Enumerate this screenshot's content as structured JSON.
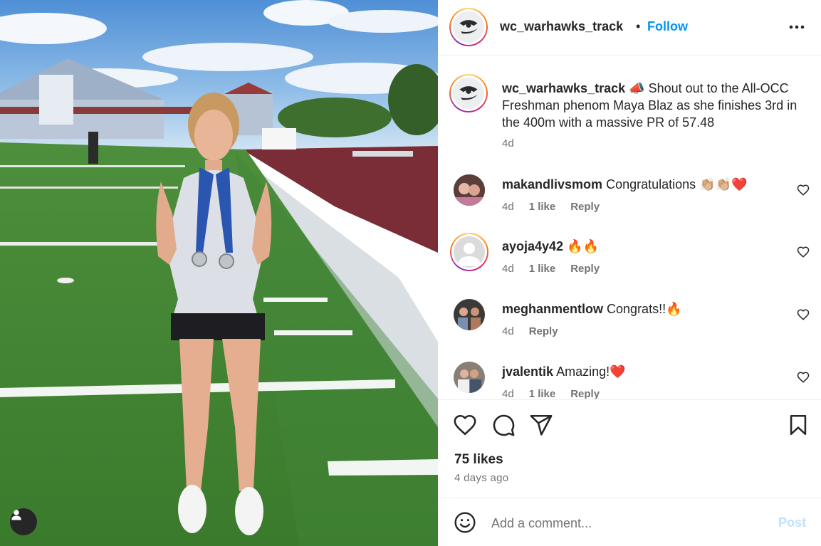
{
  "post": {
    "username": "wc_warhawks_track",
    "follow_label": "Follow",
    "separator": "•",
    "caption_emoji": "📣",
    "caption_text": "Shout out to the All-OCC Freshman phenom Maya Blaz as she finishes 3rd in the 400m with a massive PR of 57.48",
    "caption_time": "4d"
  },
  "comments": [
    {
      "username": "makandlivsmom",
      "text": "Congratulations 👏🏼👏🏼❤️",
      "time": "4d",
      "likes": "1 like",
      "reply": "Reply"
    },
    {
      "username": "ayoja4y42",
      "text": "🔥🔥",
      "time": "4d",
      "likes": "1 like",
      "reply": "Reply"
    },
    {
      "username": "meghanmentlow",
      "text": "Congrats!!🔥",
      "time": "4d",
      "reply": "Reply"
    },
    {
      "username": "jvalentik",
      "text": "Amazing!❤️",
      "time": "4d",
      "likes": "1 like",
      "reply": "Reply"
    }
  ],
  "stats": {
    "likes": "75 likes",
    "posted": "4 days ago"
  },
  "composer": {
    "placeholder": "Add a comment...",
    "post_label": "Post"
  },
  "colors": {
    "accent": "#0095f6",
    "text": "#262626",
    "secondary": "#737373",
    "post_disabled": "#c0dffd"
  },
  "icons": [
    "more-icon",
    "heart-icon",
    "comment-icon",
    "share-icon",
    "bookmark-icon",
    "emoji-icon",
    "user-tag-icon"
  ]
}
